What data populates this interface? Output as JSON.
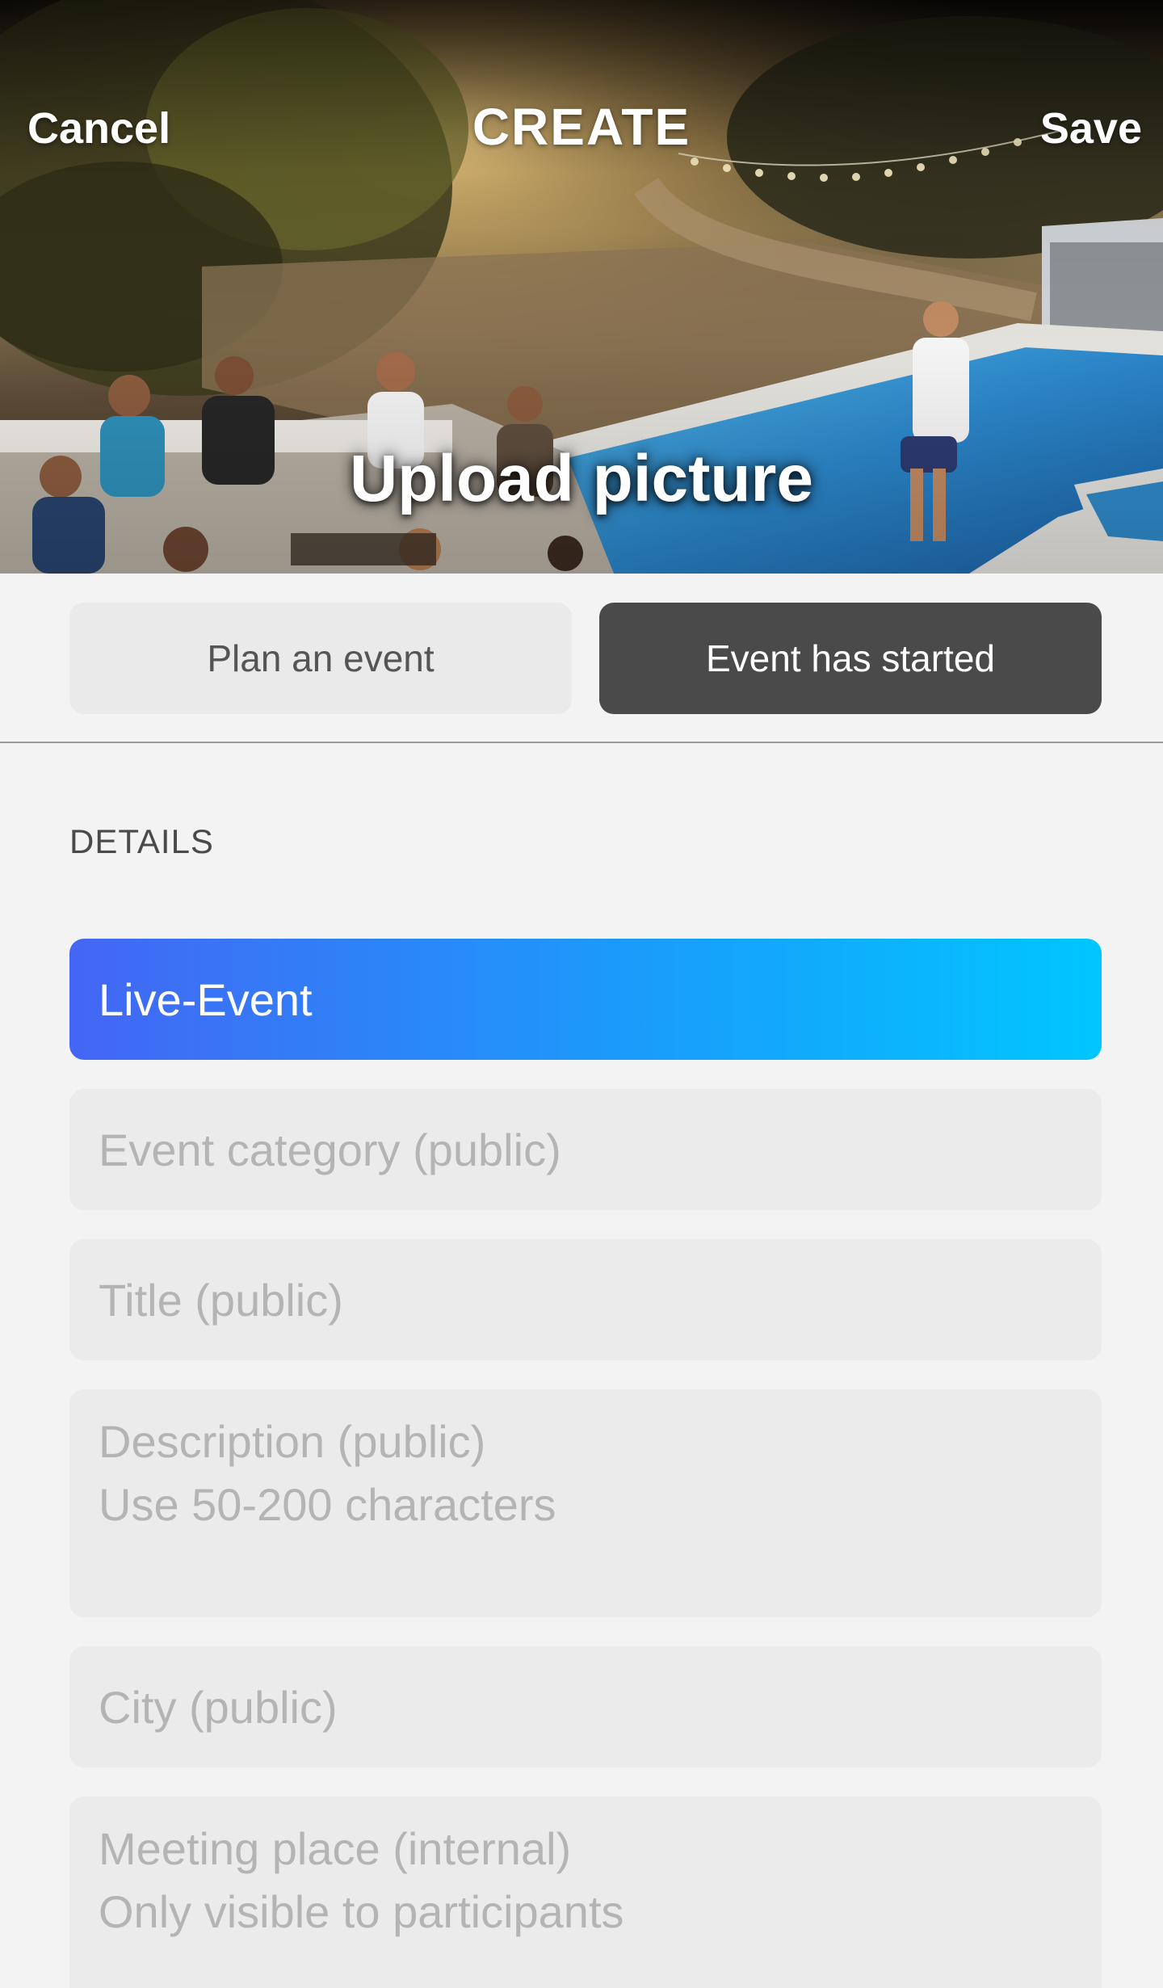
{
  "header": {
    "cancel_label": "Cancel",
    "title": "CREATE",
    "save_label": "Save",
    "upload_label": "Upload picture"
  },
  "mode_toggle": {
    "options": [
      {
        "label": "Plan an event",
        "selected": false
      },
      {
        "label": "Event has started",
        "selected": true
      }
    ]
  },
  "details": {
    "section_label": "DETAILS",
    "event_type": "Live-Event",
    "fields": {
      "category_placeholder": "Event category (public)",
      "title_placeholder": "Title (public)",
      "description_placeholder_line1": "Description (public)",
      "description_placeholder_line2": "Use 50-200 characters",
      "city_placeholder": "City (public)",
      "meeting_place_placeholder_line1": "Meeting place (internal)",
      "meeting_place_placeholder_line2": "Only visible to participants"
    }
  },
  "colors": {
    "selected_segment": "#4a4a4a",
    "live_gradient_start": "#4466f4",
    "live_gradient_end": "#00c6ff",
    "field_background": "#ebebeb",
    "placeholder_text": "#b4b4b4"
  }
}
